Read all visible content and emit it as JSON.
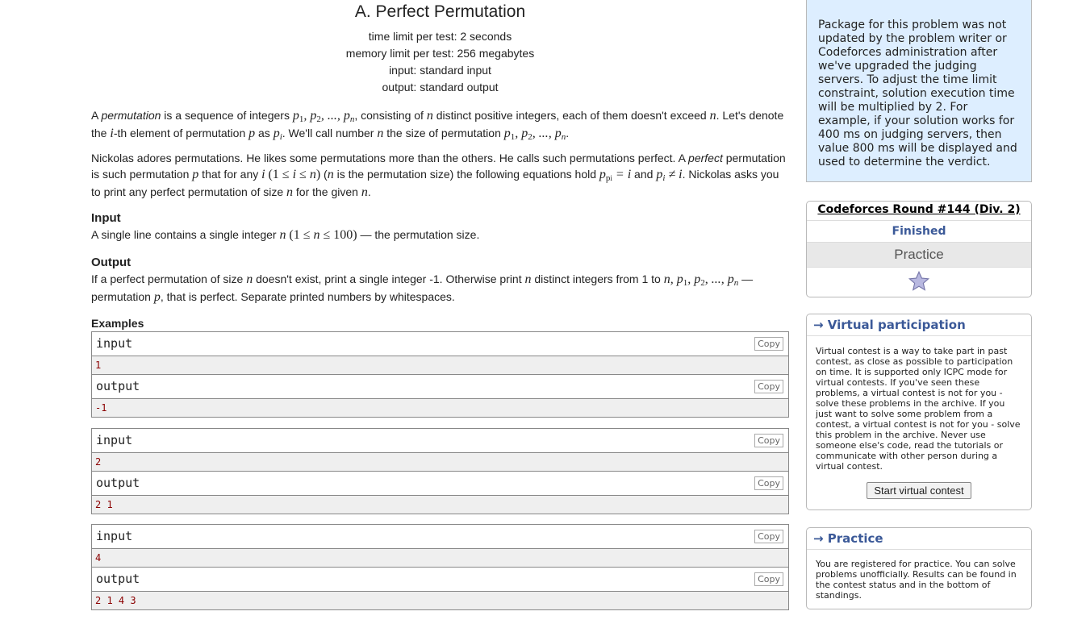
{
  "problem": {
    "title": "A. Perfect Permutation",
    "time_limit": "time limit per test: 2 seconds",
    "memory_limit": "memory limit per test: 256 megabytes",
    "input": "input: standard input",
    "output": "output: standard output",
    "p1": {
      "a": "A ",
      "perm": "permutation",
      "b": " is a sequence of integers ",
      "c": ", consisting of ",
      "d": " distinct positive integers, each of them doesn't exceed ",
      "e": ". Let's denote the ",
      "f": "-th element of permutation ",
      "g": " as ",
      "h": ". We'll call number ",
      "i": " the size of permutation "
    },
    "p2": {
      "a": "Nickolas adores permutations. He likes some permutations more than the others. He calls such permutations perfect. A ",
      "perfect": "perfect",
      "b": " permutation is such permutation ",
      "c": " that for any ",
      "d": " (",
      "e": " is the permutation size) the following equations hold ",
      "f": " and ",
      "g": ". Nickolas asks you to print any perfect permutation of size ",
      "h": " for the given "
    },
    "input_title": "Input",
    "input_text": {
      "a": "A single line contains a single integer ",
      "b": " — the permutation size."
    },
    "output_title": "Output",
    "output_text": {
      "a": "If a perfect permutation of size ",
      "b": " doesn't exist, print a single integer -1. Otherwise print ",
      "c": " distinct integers from 1 to ",
      "d": " — permutation ",
      "e": ", that is perfect. Separate printed numbers by whitespaces."
    },
    "examples_title": "Examples",
    "examples": [
      {
        "in_label": "input",
        "in": "1",
        "out_label": "output",
        "out": "-1"
      },
      {
        "in_label": "input",
        "in": "2",
        "out_label": "output",
        "out": "2 1"
      },
      {
        "in_label": "input",
        "in": "4",
        "out_label": "output",
        "out": "2 1 4 3"
      }
    ],
    "copy_label": "Copy"
  },
  "sidebar": {
    "attention": "Package for this problem was not updated by the problem writer or Codeforces administration after we've upgraded the judging servers. To adjust the time limit constraint, solution execution time will be multiplied by 2. For example, if your solution works for 400 ms on judging servers, then value 800 ms will be displayed and used to determine the verdict.",
    "round_name": "Codeforces Round #144 (Div. 2)",
    "round_status": "Finished",
    "round_mode": "Practice",
    "virtual_title": "→ Virtual participation",
    "virtual_text": "Virtual contest is a way to take part in past contest, as close as possible to participation on time. It is supported only ICPC mode for virtual contests. If you've seen these problems, a virtual contest is not for you - solve these problems in the archive. If you just want to solve some problem from a contest, a virtual contest is not for you - solve this problem in the archive. Never use someone else's code, read the tutorials or communicate with other person during a virtual contest.",
    "virtual_button": "Start virtual contest",
    "practice_title": "→ Practice",
    "practice_text": "You are registered for practice. You can solve problems unofficially. Results can be found in the contest status and in the bottom of standings."
  }
}
